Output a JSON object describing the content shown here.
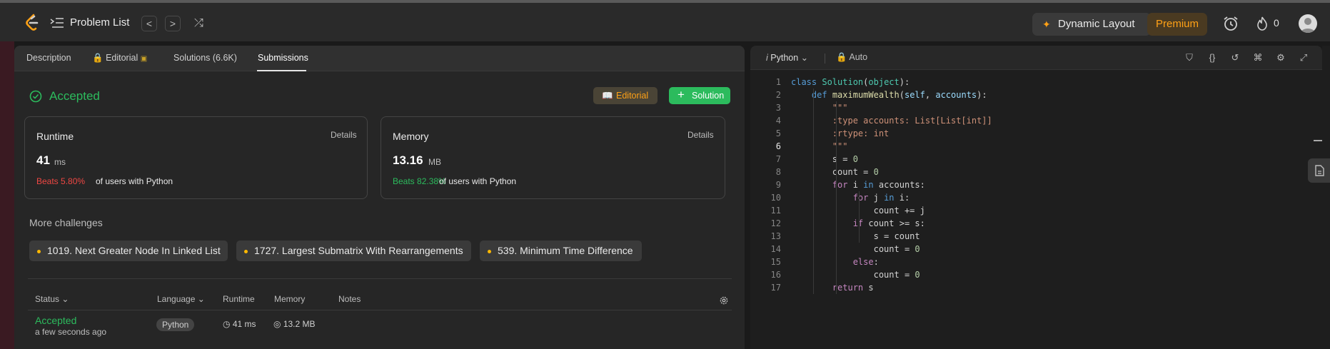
{
  "topbar": {
    "problem_list": "Problem List",
    "prev": "<",
    "next": ">",
    "shuffle": "⤮",
    "dynamic_layout": "Dynamic Layout",
    "premium": "Premium",
    "streak_count": "0",
    "accent": "#ffa116"
  },
  "tabs": {
    "description": "Description",
    "editorial": "Editorial",
    "solutions": "Solutions (6.6K)",
    "submissions": "Submissions"
  },
  "result": {
    "status": "Accepted",
    "editorial_btn": "Editorial",
    "solution_btn": "Solution",
    "status_color": "#2cbb5d"
  },
  "runtime": {
    "title": "Runtime",
    "details": "Details",
    "value": "41",
    "unit": "ms",
    "beats": "Beats 5.80%",
    "beats_tail": "of users with Python",
    "beats_color": "#ef4743"
  },
  "memory": {
    "title": "Memory",
    "details": "Details",
    "value": "13.16",
    "unit": "MB",
    "beats": "Beats 82.38%",
    "beats_tail": "of users with Python",
    "beats_color": "#2cbb5d"
  },
  "challenges": {
    "label": "More challenges",
    "items": [
      "1019. Next Greater Node In Linked List",
      "1727. Largest Submatrix With Rearrangements",
      "539. Minimum Time Difference"
    ]
  },
  "table": {
    "headers": {
      "status": "Status",
      "language": "Language",
      "runtime": "Runtime",
      "memory": "Memory",
      "notes": "Notes"
    },
    "row": {
      "status": "Accepted",
      "time": "a few seconds ago",
      "language": "Python",
      "runtime": "41 ms",
      "memory": "13.2 MB"
    }
  },
  "editor": {
    "language": "Python",
    "mode": "Auto",
    "current_line": 6,
    "lines": [
      "class Solution(object):",
      "    def maximumWealth(self, accounts):",
      "        \"\"\"",
      "        :type accounts: List[List[int]]",
      "        :rtype: int",
      "        \"\"\"",
      "        s = 0",
      "        count = 0",
      "        for i in accounts:",
      "            for j in i:",
      "                count += j",
      "            if count >= s:",
      "                s = count",
      "                count = 0",
      "            else:",
      "                count = 0",
      "        return s"
    ],
    "line_numbers": [
      "1",
      "2",
      "3",
      "4",
      "5",
      "6",
      "7",
      "8",
      "9",
      "10",
      "11",
      "12",
      "13",
      "14",
      "15",
      "16",
      "17"
    ]
  }
}
